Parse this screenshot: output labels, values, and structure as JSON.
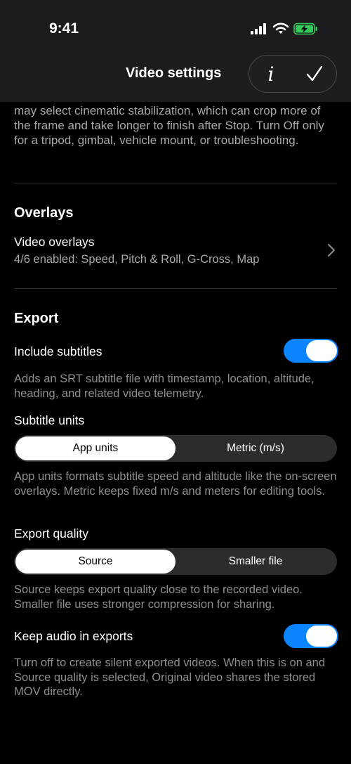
{
  "status_bar": {
    "time": "9:41"
  },
  "nav": {
    "title": "Video settings",
    "info_label": "i"
  },
  "top_text": "may select cinematic stabilization, which can crop more of the frame and take longer to finish after Stop. Turn Off only for a tripod, gimbal, vehicle mount, or troubleshooting.",
  "overlays": {
    "title": "Overlays",
    "video_overlays_label": "Video overlays",
    "video_overlays_value": "4/6 enabled: Speed, Pitch & Roll, G-Cross, Map"
  },
  "export": {
    "title": "Export",
    "include_subtitles_label": "Include subtitles",
    "include_subtitles_on": true,
    "include_subtitles_desc": "Adds an SRT subtitle file with timestamp, location, altitude, heading, and related video telemetry.",
    "subtitle_units_label": "Subtitle units",
    "subtitle_units_options": [
      "App units",
      "Metric (m/s)"
    ],
    "subtitle_units_selected": "App units",
    "subtitle_units_desc": "App units formats subtitle speed and altitude like the on-screen overlays. Metric keeps fixed m/s and meters for editing tools.",
    "export_quality_label": "Export quality",
    "export_quality_options": [
      "Source",
      "Smaller file"
    ],
    "export_quality_selected": "Source",
    "export_quality_desc": "Source keeps export quality close to the recorded video. Smaller file uses stronger compression for sharing.",
    "keep_audio_label": "Keep audio in exports",
    "keep_audio_on": true,
    "keep_audio_desc": "Turn off to create silent exported videos. When this is on and Source quality is selected, Original video shares the stored MOV directly."
  },
  "colors": {
    "accent": "#0a84ff",
    "battery": "#34c759",
    "background": "#000000",
    "header": "#1c1c1e"
  }
}
